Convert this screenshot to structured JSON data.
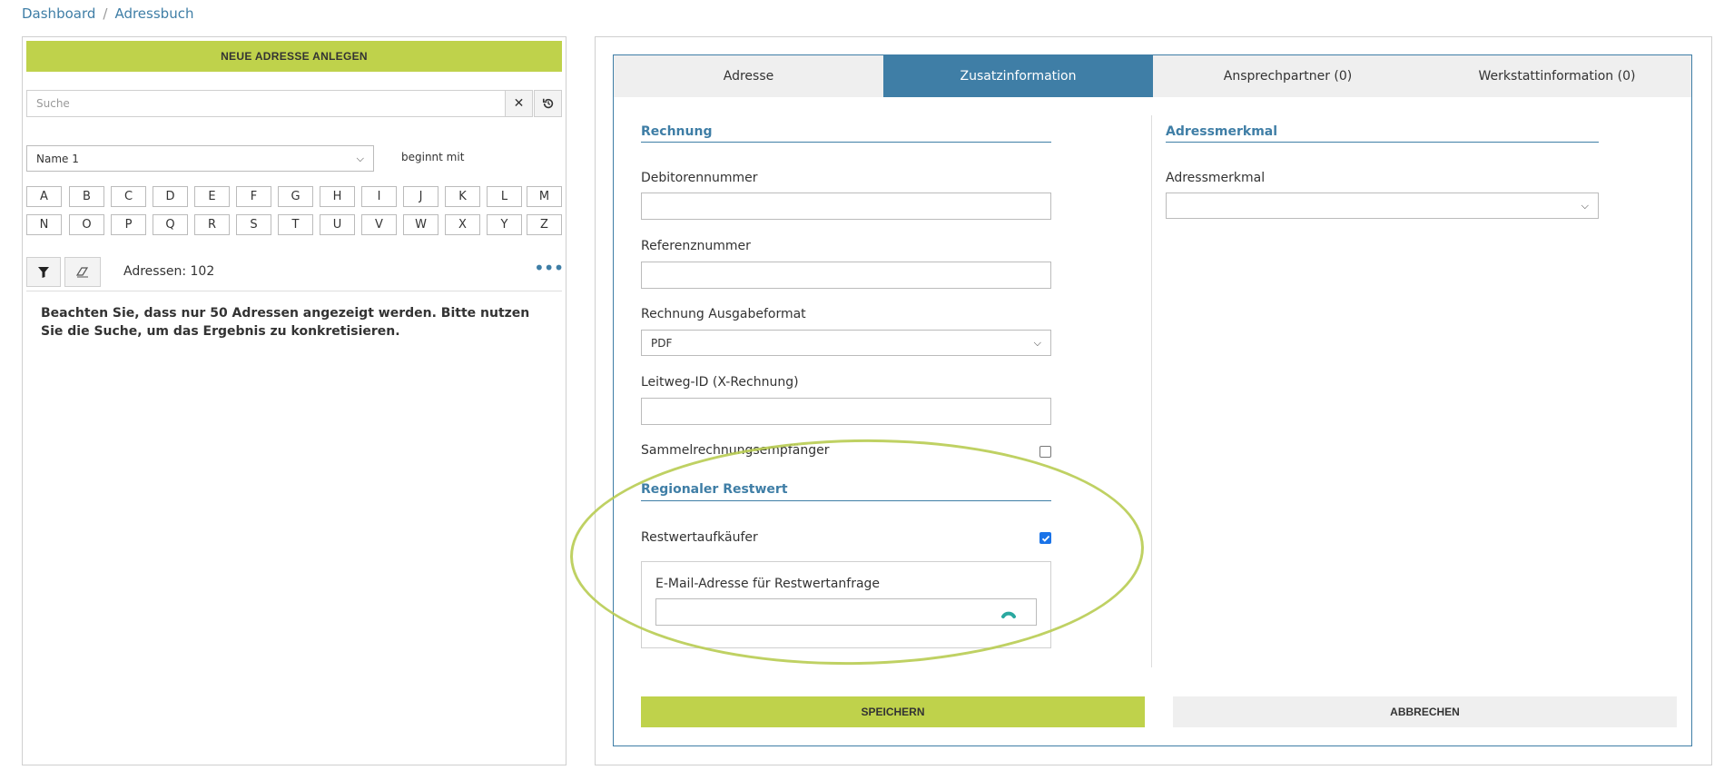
{
  "breadcrumb": {
    "items": [
      "Dashboard",
      "Adressbuch"
    ],
    "separator": "/"
  },
  "left": {
    "new_button": "NEUE ADRESSE ANLEGEN",
    "search_placeholder": "Suche",
    "name_select_value": "Name 1",
    "begins_with": "beginnt mit",
    "letters_row1": [
      "A",
      "B",
      "C",
      "D",
      "E",
      "F",
      "G",
      "H",
      "I",
      "J",
      "K",
      "L",
      "M"
    ],
    "letters_row2": [
      "N",
      "O",
      "P",
      "Q",
      "R",
      "S",
      "T",
      "U",
      "V",
      "W",
      "X",
      "Y",
      "Z"
    ],
    "count_label": "Adressen: 102",
    "notice": "Beachten Sie, dass nur 50 Adressen angezeigt werden. Bitte nutzen Sie die Suche, um das Ergebnis zu konkretisieren."
  },
  "tabs": [
    "Adresse",
    "Zusatzinformation",
    "Ansprechpartner (0)",
    "Werkstattinformation (0)"
  ],
  "active_tab": "Zusatzinformation",
  "form": {
    "rechnung_title": "Rechnung",
    "debitor_label": "Debitorennummer",
    "referenz_label": "Referenznummer",
    "ausgabe_label": "Rechnung Ausgabeformat",
    "ausgabe_value": "PDF",
    "leitweg_label": "Leitweg-ID (X-Rechnung)",
    "sammel_label": "Sammelrechnungsempfänger",
    "sammel_checked": false,
    "regional_title": "Regionaler Restwert",
    "restwert_label": "Restwertaufkäufer",
    "restwert_checked": true,
    "email_label": "E-Mail-Adresse für Restwertanfrage",
    "adressmerkmal_title": "Adressmerkmal",
    "adressmerkmal_label": "Adressmerkmal",
    "adressmerkmal_value": ""
  },
  "actions": {
    "save": "SPEICHERN",
    "cancel": "ABBRECHEN"
  },
  "colors": {
    "accent": "#bfd24b",
    "primary": "#3f7ea6",
    "checkbox": "#1a73e8"
  }
}
